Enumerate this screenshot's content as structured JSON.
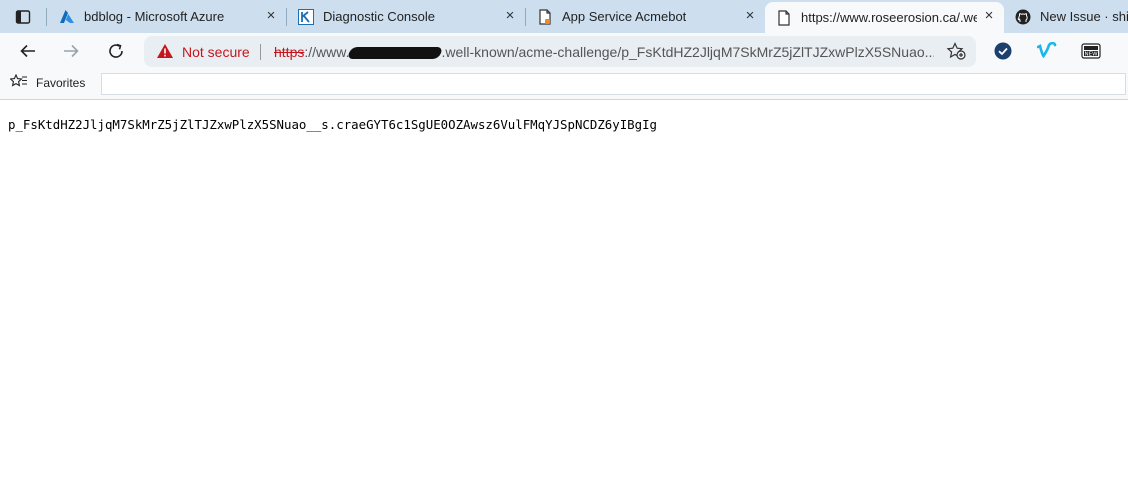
{
  "tabs": [
    {
      "title": "bdblog - Microsoft Azure",
      "icon": "azure-icon"
    },
    {
      "title": "Diagnostic Console",
      "icon": "kudu-icon"
    },
    {
      "title": "App Service Acmebot",
      "icon": "document-icon"
    },
    {
      "title": "https://www.roseerosion.ca/.well",
      "icon": "document-icon"
    },
    {
      "title": "New Issue · shiba",
      "icon": "github-icon"
    }
  ],
  "address_bar": {
    "security_label": "Not secure",
    "scheme": "https",
    "prefix": "://www.",
    "path": ".well-known/acme-challenge/p_FsKtdHZ2JljqM7SkMrZ5jZlTJZxwPlzX5SNuao..."
  },
  "favorites": {
    "label": "Favorites"
  },
  "content": {
    "text": "p_FsKtdHZ2JljqM7SkMrZ5jZlTJZxwPlzX5SNuao__s.craeGYT6c1SgUE0OZAwsz6VulFMqYJSpNCDZ6yIBgIg"
  },
  "colors": {
    "accent": "#0f6cbd",
    "warning": "#c5161d",
    "tabstrip": "#cddfef"
  }
}
